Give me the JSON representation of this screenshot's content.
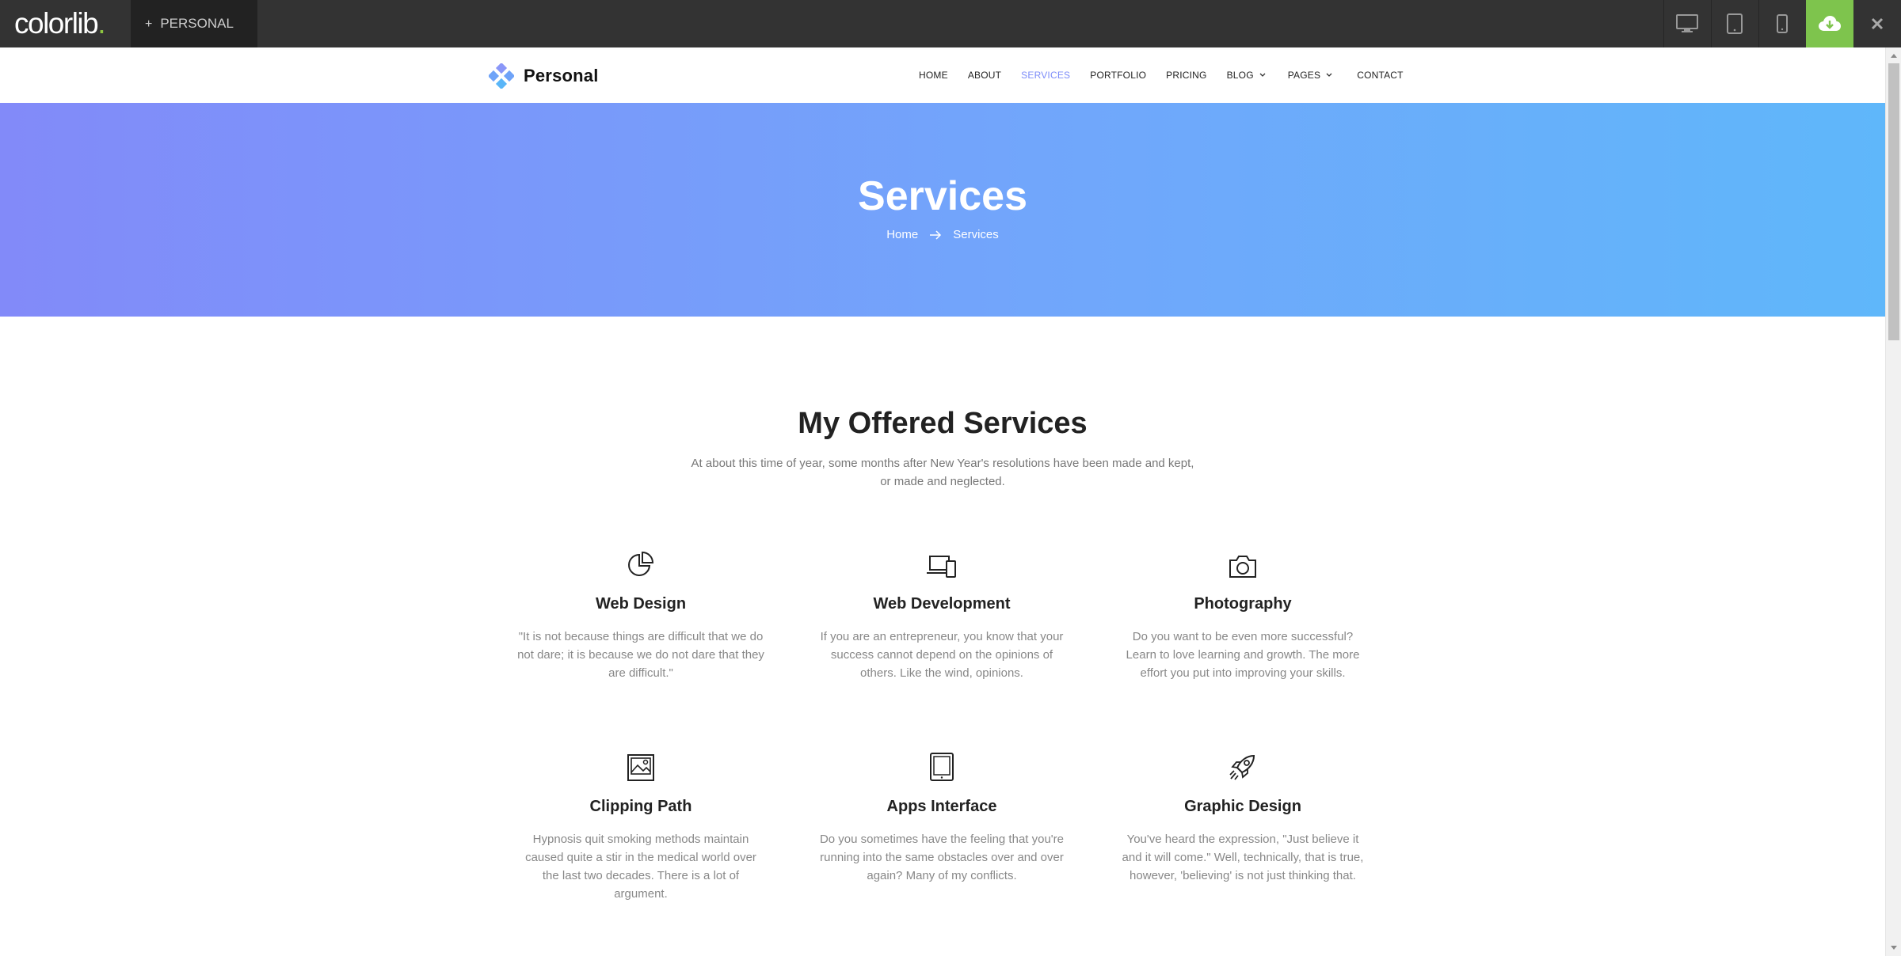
{
  "preview_bar": {
    "logo": "colorlib",
    "logo_dot": ".",
    "theme_tab": "PERSONAL",
    "theme_tab_plus": "+",
    "devices": [
      "desktop-icon",
      "tablet-icon",
      "mobile-icon"
    ],
    "download_icon": "cloud-download-icon",
    "close_icon": "close-icon",
    "accent": "#7ec44d"
  },
  "site": {
    "brand": "Personal",
    "nav": [
      {
        "label": "HOME"
      },
      {
        "label": "ABOUT"
      },
      {
        "label": "SERVICES",
        "active": true
      },
      {
        "label": "PORTFOLIO"
      },
      {
        "label": "PRICING"
      },
      {
        "label": "BLOG",
        "dropdown": true
      },
      {
        "label": "PAGES",
        "dropdown": true
      },
      {
        "label": "CONTACT"
      }
    ],
    "active_color": "#7c8cf9"
  },
  "hero": {
    "title": "Services",
    "breadcrumb": [
      "Home",
      "Services"
    ],
    "gradient": [
      "#828af9",
      "#5fb7fa"
    ]
  },
  "services": {
    "title": "My Offered Services",
    "subtitle": "At about this time of year, some months after New Year's resolutions have been made and kept, or made and neglected.",
    "items": [
      {
        "icon": "pie-chart-icon",
        "title": "Web Design",
        "text": "\"It is not because things are difficult that we do not dare; it is because we do not dare that they are difficult.\""
      },
      {
        "icon": "devices-icon",
        "title": "Web Development",
        "text": "If you are an entrepreneur, you know that your success cannot depend on the opinions of others. Like the wind, opinions."
      },
      {
        "icon": "camera-icon",
        "title": "Photography",
        "text": "Do you want to be even more successful? Learn to love learning and growth. The more effort you put into improving your skills."
      },
      {
        "icon": "image-icon",
        "title": "Clipping Path",
        "text": "Hypnosis quit smoking methods maintain caused quite a stir in the medical world over the last two decades. There is a lot of argument."
      },
      {
        "icon": "tablet-icon",
        "title": "Apps Interface",
        "text": "Do you sometimes have the feeling that you're running into the same obstacles over and over again? Many of my conflicts."
      },
      {
        "icon": "rocket-icon",
        "title": "Graphic Design",
        "text": "You've heard the expression, \"Just believe it and it will come.\" Well, technically, that is true, however, 'believing' is not just thinking that."
      }
    ]
  }
}
